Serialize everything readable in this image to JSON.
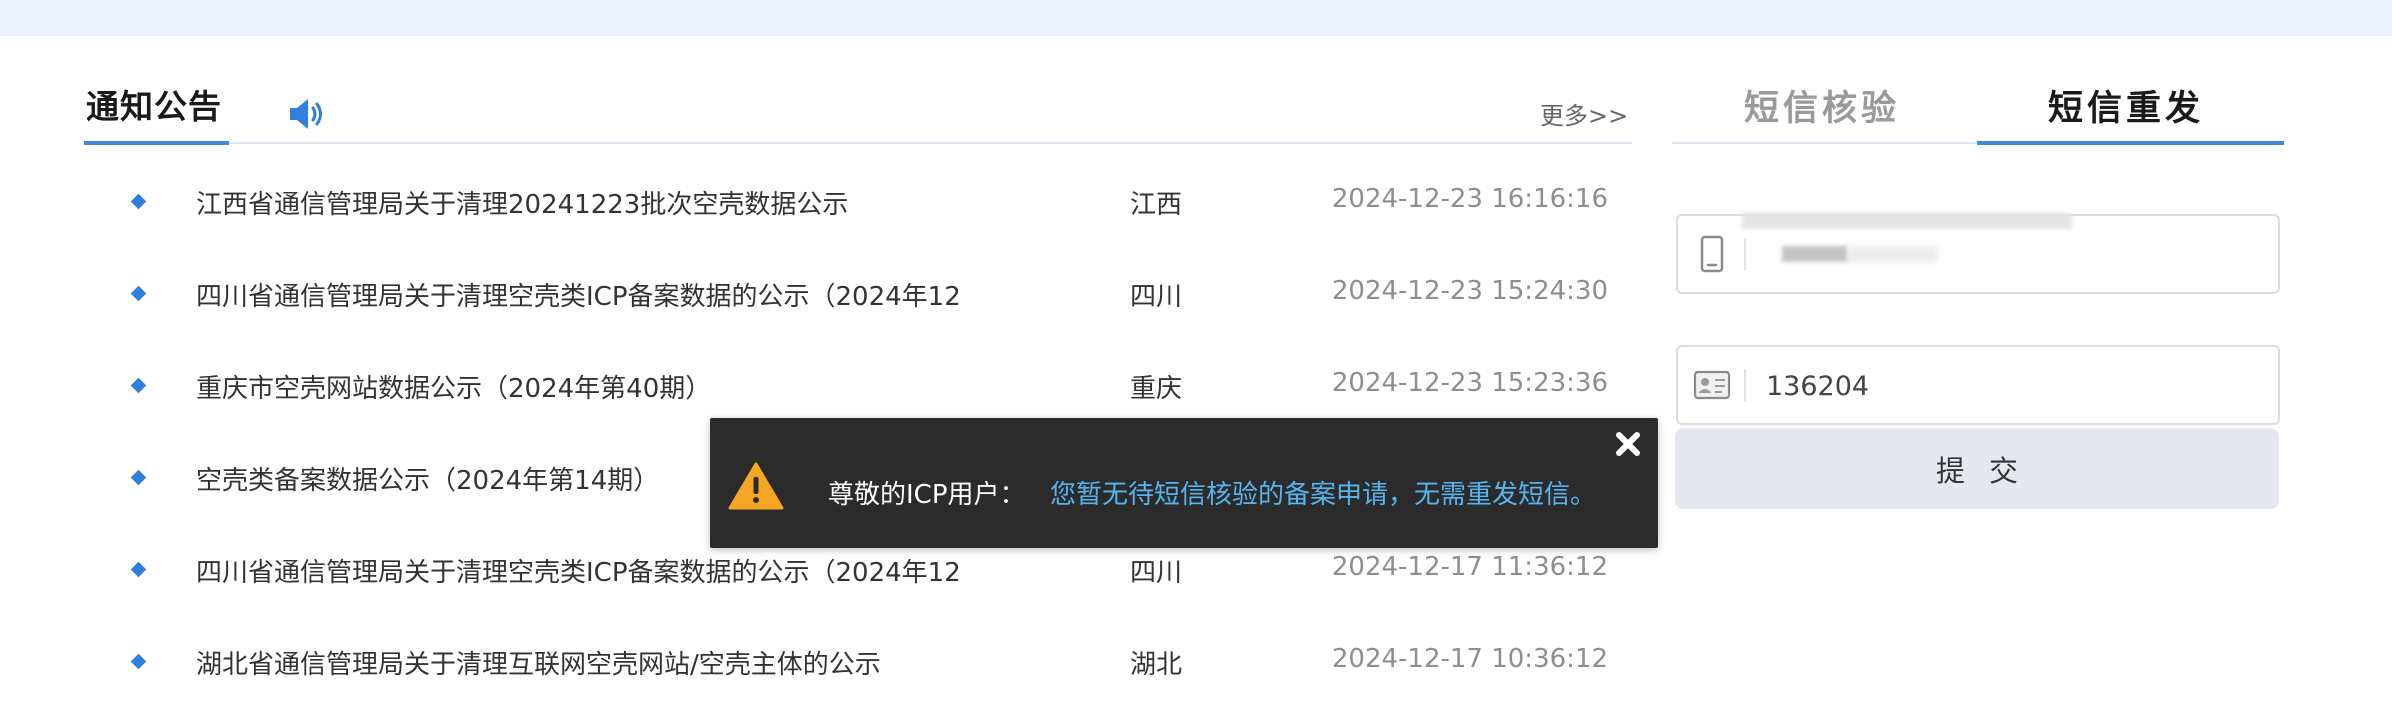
{
  "notice": {
    "title": "通知公告",
    "more": "更多>>",
    "items": [
      {
        "title": "江西省通信管理局关于清理20241223批次空壳数据公示",
        "region": "江西",
        "time": "2024-12-23 16:16:16"
      },
      {
        "title": "四川省通信管理局关于清理空壳类ICP备案数据的公示（2024年12",
        "region": "四川",
        "time": "2024-12-23 15:24:30"
      },
      {
        "title": "重庆市空壳网站数据公示（2024年第40期）",
        "region": "重庆",
        "time": "2024-12-23 15:23:36"
      },
      {
        "title": "空壳类备案数据公示（2024年第14期）",
        "region": "",
        "time": ""
      },
      {
        "title": "四川省通信管理局关于清理空壳类ICP备案数据的公示（2024年12",
        "region": "四川",
        "time": "2024-12-17 11:36:12"
      },
      {
        "title": "湖北省通信管理局关于清理互联网空壳网站/空壳主体的公示",
        "region": "湖北",
        "time": "2024-12-17 10:36:12"
      }
    ]
  },
  "sms": {
    "tabs": [
      {
        "label": "短信核验",
        "active": false
      },
      {
        "label": "短信重发",
        "active": true
      }
    ],
    "phone_value": "",
    "code_value": "136204",
    "submit_label": "提交"
  },
  "toast": {
    "label": "尊敬的ICP用户：",
    "message": "您暂无待短信核验的备案申请，无需重发短信。"
  },
  "icons": {
    "speaker": "speaker-icon",
    "phone": "phone-icon",
    "id_card": "id-card-icon",
    "warning": "warning-icon",
    "close": "close-icon"
  },
  "colors": {
    "accent": "#3d8bd9",
    "bullet": "#2f7fdc",
    "toast_bg": "#2b2b2b",
    "toast_message": "#57b4ee",
    "warning": "#f5a623",
    "submit_bg": "#e5e8ef"
  }
}
